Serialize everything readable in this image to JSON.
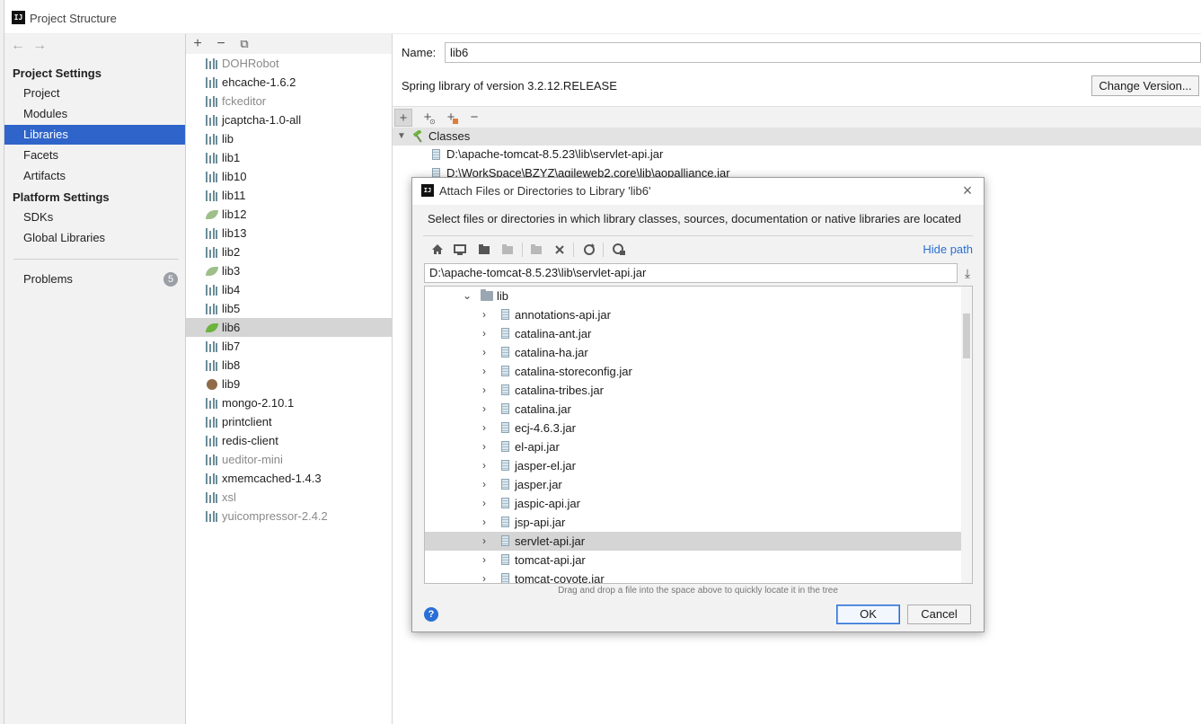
{
  "window": {
    "title": "Project Structure",
    "logo_text": "IJ"
  },
  "sidebar": {
    "nav": {
      "back": "←",
      "forward": "→"
    },
    "project_settings_header": "Project Settings",
    "project_items": [
      {
        "label": "Project"
      },
      {
        "label": "Modules"
      },
      {
        "label": "Libraries",
        "selected": true
      },
      {
        "label": "Facets"
      },
      {
        "label": "Artifacts"
      }
    ],
    "platform_settings_header": "Platform Settings",
    "platform_items": [
      {
        "label": "SDKs"
      },
      {
        "label": "Global Libraries"
      }
    ],
    "problems": {
      "label": "Problems",
      "count": "5"
    }
  },
  "library_list": {
    "toolbar": {
      "add": "+",
      "remove": "−",
      "copy": "⧉"
    },
    "items": [
      {
        "label": "DOHRobot",
        "icon": "library-bars-icon",
        "grey": true
      },
      {
        "label": "ehcache-1.6.2",
        "icon": "library-bars-icon"
      },
      {
        "label": "fckeditor",
        "icon": "library-bars-icon",
        "grey": true
      },
      {
        "label": "jcaptcha-1.0-all",
        "icon": "library-bars-icon"
      },
      {
        "label": "lib",
        "icon": "library-bars-icon"
      },
      {
        "label": "lib1",
        "icon": "library-bars-icon"
      },
      {
        "label": "lib10",
        "icon": "library-bars-icon"
      },
      {
        "label": "lib11",
        "icon": "library-bars-icon"
      },
      {
        "label": "lib12",
        "icon": "spring-leaf-icon"
      },
      {
        "label": "lib13",
        "icon": "library-bars-icon"
      },
      {
        "label": "lib2",
        "icon": "library-bars-icon"
      },
      {
        "label": "lib3",
        "icon": "spring-leaf-icon"
      },
      {
        "label": "lib4",
        "icon": "library-bars-icon"
      },
      {
        "label": "lib5",
        "icon": "library-bars-icon"
      },
      {
        "label": "lib6",
        "icon": "spring-leaf-icon",
        "selected": true
      },
      {
        "label": "lib7",
        "icon": "library-bars-icon"
      },
      {
        "label": "lib8",
        "icon": "library-bars-icon"
      },
      {
        "label": "lib9",
        "icon": "brown-library-icon"
      },
      {
        "label": "mongo-2.10.1",
        "icon": "library-bars-icon"
      },
      {
        "label": "printclient",
        "icon": "library-bars-icon"
      },
      {
        "label": "redis-client",
        "icon": "library-bars-icon"
      },
      {
        "label": "ueditor-mini",
        "icon": "library-bars-icon",
        "grey": true
      },
      {
        "label": "xmemcached-1.4.3",
        "icon": "library-bars-icon"
      },
      {
        "label": "xsl",
        "icon": "library-bars-icon",
        "grey": true
      },
      {
        "label": "yuicompressor-2.4.2",
        "icon": "library-bars-icon",
        "grey": true
      }
    ]
  },
  "main": {
    "name_label": "Name:",
    "name_value": "lib6",
    "spring_description": "Spring library of version 3.2.12.RELEASE",
    "change_version_label": "Change Version...",
    "toolbar": {
      "add": "+",
      "add_classes": "+",
      "add_jar": "+",
      "remove": "−"
    },
    "classes_label": "Classes",
    "class_entries": [
      "D:\\apache-tomcat-8.5.23\\lib\\servlet-api.jar",
      "D:\\WorkSpace\\BZYZ\\agileweb2.core\\lib\\aopalliance.jar"
    ]
  },
  "dialog": {
    "title": "Attach Files or Directories to Library 'lib6'",
    "close": "×",
    "description": "Select files or directories in which library classes, sources, documentation or native libraries are located",
    "hide_path_label": "Hide path",
    "path_value": "D:\\apache-tomcat-8.5.23\\lib\\servlet-api.jar",
    "download": "⤓",
    "tree_folder": {
      "label": "lib",
      "chevron": "⌄"
    },
    "tree_items": [
      {
        "label": "annotations-api.jar"
      },
      {
        "label": "catalina-ant.jar"
      },
      {
        "label": "catalina-ha.jar"
      },
      {
        "label": "catalina-storeconfig.jar"
      },
      {
        "label": "catalina-tribes.jar"
      },
      {
        "label": "catalina.jar"
      },
      {
        "label": "ecj-4.6.3.jar"
      },
      {
        "label": "el-api.jar"
      },
      {
        "label": "jasper-el.jar"
      },
      {
        "label": "jasper.jar"
      },
      {
        "label": "jaspic-api.jar"
      },
      {
        "label": "jsp-api.jar"
      },
      {
        "label": "servlet-api.jar",
        "selected": true
      },
      {
        "label": "tomcat-api.jar"
      },
      {
        "label": "tomcat-coyote.jar"
      }
    ],
    "tree_chevron": "›",
    "drag_hint": "Drag and drop a file into the space above to quickly locate it in the tree",
    "help": "?",
    "ok_label": "OK",
    "cancel_label": "Cancel"
  },
  "colors": {
    "selection_blue": "#2f65ca",
    "link_blue": "#2a6fd6",
    "spring_green": "#6db33f",
    "list_selection_grey": "#d5d5d5"
  }
}
